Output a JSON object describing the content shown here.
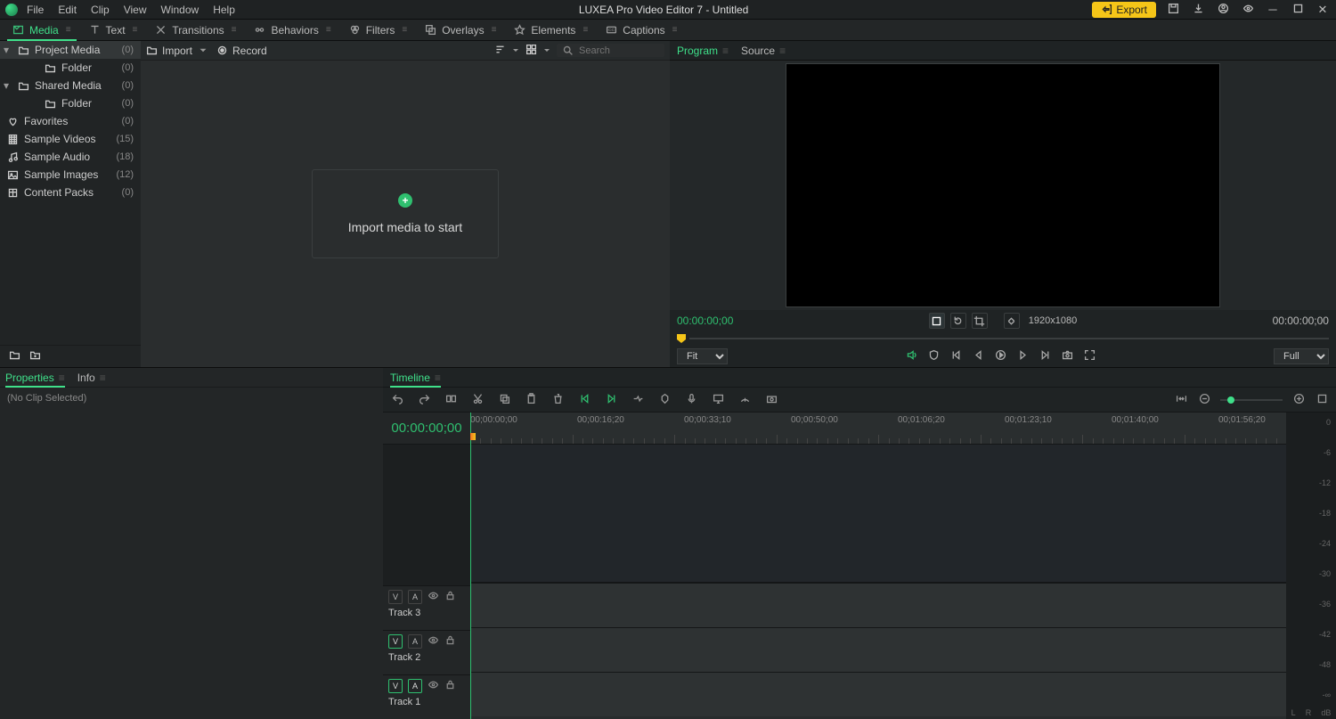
{
  "titlebar": {
    "menus": [
      "File",
      "Edit",
      "Clip",
      "View",
      "Window",
      "Help"
    ],
    "title": "LUXEA Pro Video Editor 7 - Untitled",
    "export": "Export"
  },
  "topTabs": [
    {
      "label": "Media",
      "icon": "media",
      "active": true
    },
    {
      "label": "Text",
      "icon": "text"
    },
    {
      "label": "Transitions",
      "icon": "trans"
    },
    {
      "label": "Behaviors",
      "icon": "behav"
    },
    {
      "label": "Filters",
      "icon": "filters"
    },
    {
      "label": "Overlays",
      "icon": "overlay"
    },
    {
      "label": "Elements",
      "icon": "elems"
    },
    {
      "label": "Captions",
      "icon": "cc"
    }
  ],
  "sidebar": {
    "items": [
      {
        "label": "Project Media",
        "count": "(0)",
        "kind": "root",
        "selected": true,
        "icon": "folder"
      },
      {
        "label": "Folder",
        "count": "(0)",
        "kind": "child",
        "icon": "folder"
      },
      {
        "label": "Shared Media",
        "count": "(0)",
        "kind": "root",
        "icon": "folder"
      },
      {
        "label": "Folder",
        "count": "(0)",
        "kind": "child",
        "icon": "folder"
      },
      {
        "label": "Favorites",
        "count": "(0)",
        "kind": "item",
        "icon": "heart"
      },
      {
        "label": "Sample Videos",
        "count": "(15)",
        "kind": "item",
        "icon": "film"
      },
      {
        "label": "Sample Audio",
        "count": "(18)",
        "kind": "item",
        "icon": "music"
      },
      {
        "label": "Sample Images",
        "count": "(12)",
        "kind": "item",
        "icon": "image"
      },
      {
        "label": "Content Packs",
        "count": "(0)",
        "kind": "item",
        "icon": "box"
      }
    ]
  },
  "mediaBar": {
    "import": "Import",
    "record": "Record",
    "searchPlaceholder": "Search"
  },
  "importCard": "Import media to start",
  "previewTabs": [
    {
      "label": "Program",
      "active": true
    },
    {
      "label": "Source"
    }
  ],
  "preview": {
    "tcLeft": "00:00:00;00",
    "resolution": "1920x1080",
    "tcRight": "00:00:00;00",
    "fit": "Fit",
    "full": "Full"
  },
  "propsTabs": [
    {
      "label": "Properties",
      "active": true
    },
    {
      "label": "Info"
    }
  ],
  "propsBody": "(No Clip Selected)",
  "timelineTab": "Timeline",
  "timeline": {
    "tc": "00:00:00;00",
    "ruler": [
      "00;00:00;00",
      "00;00:16;20",
      "00;00:33;10",
      "00;00:50;00",
      "00;01:06;20",
      "00;01:23;10",
      "00;01:40;00",
      "00;01:56;20"
    ],
    "tracks": [
      {
        "name": "Track 3",
        "v": false,
        "a": false
      },
      {
        "name": "Track 2",
        "v": true,
        "a": false
      },
      {
        "name": "Track 1",
        "v": true,
        "a": true
      }
    ]
  },
  "meter": {
    "labels": [
      "0",
      "-6",
      "-12",
      "-18",
      "-24",
      "-30",
      "-36",
      "-42",
      "-48",
      "-∞"
    ],
    "unit": "dB",
    "L": "L",
    "R": "R"
  }
}
